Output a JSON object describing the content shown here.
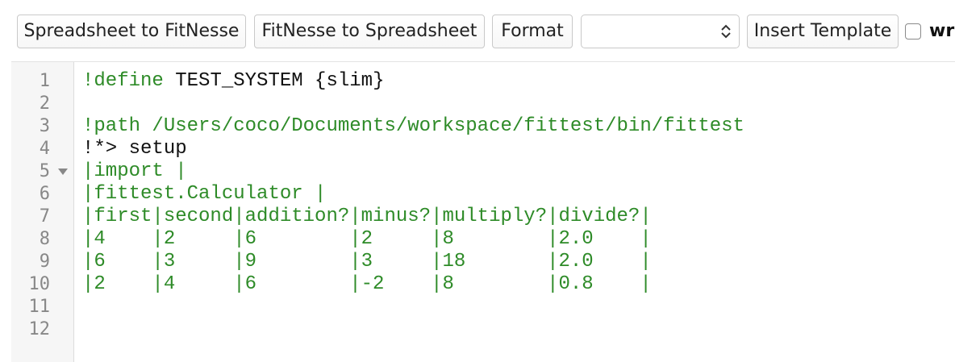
{
  "toolbar": {
    "spreadsheet_to_fitnesse": "Spreadsheet to FitNesse",
    "fitnesse_to_spreadsheet": "FitNesse to Spreadsheet",
    "format": "Format",
    "template_select_value": "",
    "insert_template": "Insert Template",
    "wrap_label": "wr"
  },
  "editor": {
    "line_numbers": [
      "1",
      "2",
      "3",
      "4",
      "5",
      "6",
      "7",
      "8",
      "9",
      "10",
      "11",
      "12"
    ],
    "lines": {
      "l1_kw": "!define",
      "l1_rest": " TEST_SYSTEM {slim}",
      "l3": "!path /Users/coco/Documents/workspace/fittest/bin/fittest",
      "l4": "!*> setup",
      "l5": "|import |",
      "l6": "|fittest.Calculator |",
      "l7": "|first|second|addition?|minus?|multiply?|divide?|",
      "l8": "|4    |2     |6        |2     |8        |2.0    |",
      "l9": "|6    |3     |9        |3     |18       |2.0    |",
      "l10": "|2    |4     |6        |-2    |8        |0.8    |"
    }
  },
  "colors": {
    "keyword": "#2e8b28",
    "text": "#111111"
  }
}
